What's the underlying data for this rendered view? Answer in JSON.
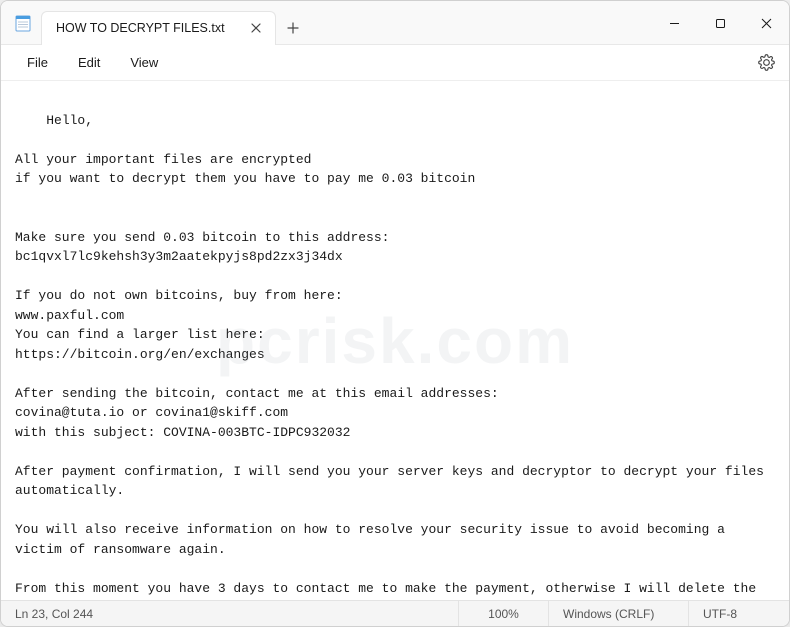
{
  "tab": {
    "title": "HOW TO DECRYPT FILES.txt"
  },
  "menu": {
    "file": "File",
    "edit": "Edit",
    "view": "View"
  },
  "document": {
    "text": "Hello,\n\nAll your important files are encrypted\nif you want to decrypt them you have to pay me 0.03 bitcoin\n\n\nMake sure you send 0.03 bitcoin to this address:\nbc1qvxl7lc9kehsh3y3m2aatekpyjs8pd2zx3j34dx\n\nIf you do not own bitcoins, buy from here:\nwww.paxful.com\nYou can find a larger list here:\nhttps://bitcoin.org/en/exchanges\n\nAfter sending the bitcoin, contact me at this email addresses:\ncovina@tuta.io or covina1@skiff.com\nwith this subject: COVINA-003BTC-IDPC932032\n\nAfter payment confirmation, I will send you your server keys and decryptor to decrypt your files automatically.\n\nYou will also receive information on how to resolve your security issue to avoid becoming a victim of ransomware again.\n\nFrom this moment you have 3 days to contact me to make the payment, otherwise I will delete the keys, and be sure that no one will be able to decrypt your files without the original keys, you can try but you will lose your time and your files."
  },
  "statusbar": {
    "cursor": "Ln 23, Col 244",
    "zoom": "100%",
    "lineEnding": "Windows (CRLF)",
    "encoding": "UTF-8"
  },
  "watermark": "pcrisk.com"
}
